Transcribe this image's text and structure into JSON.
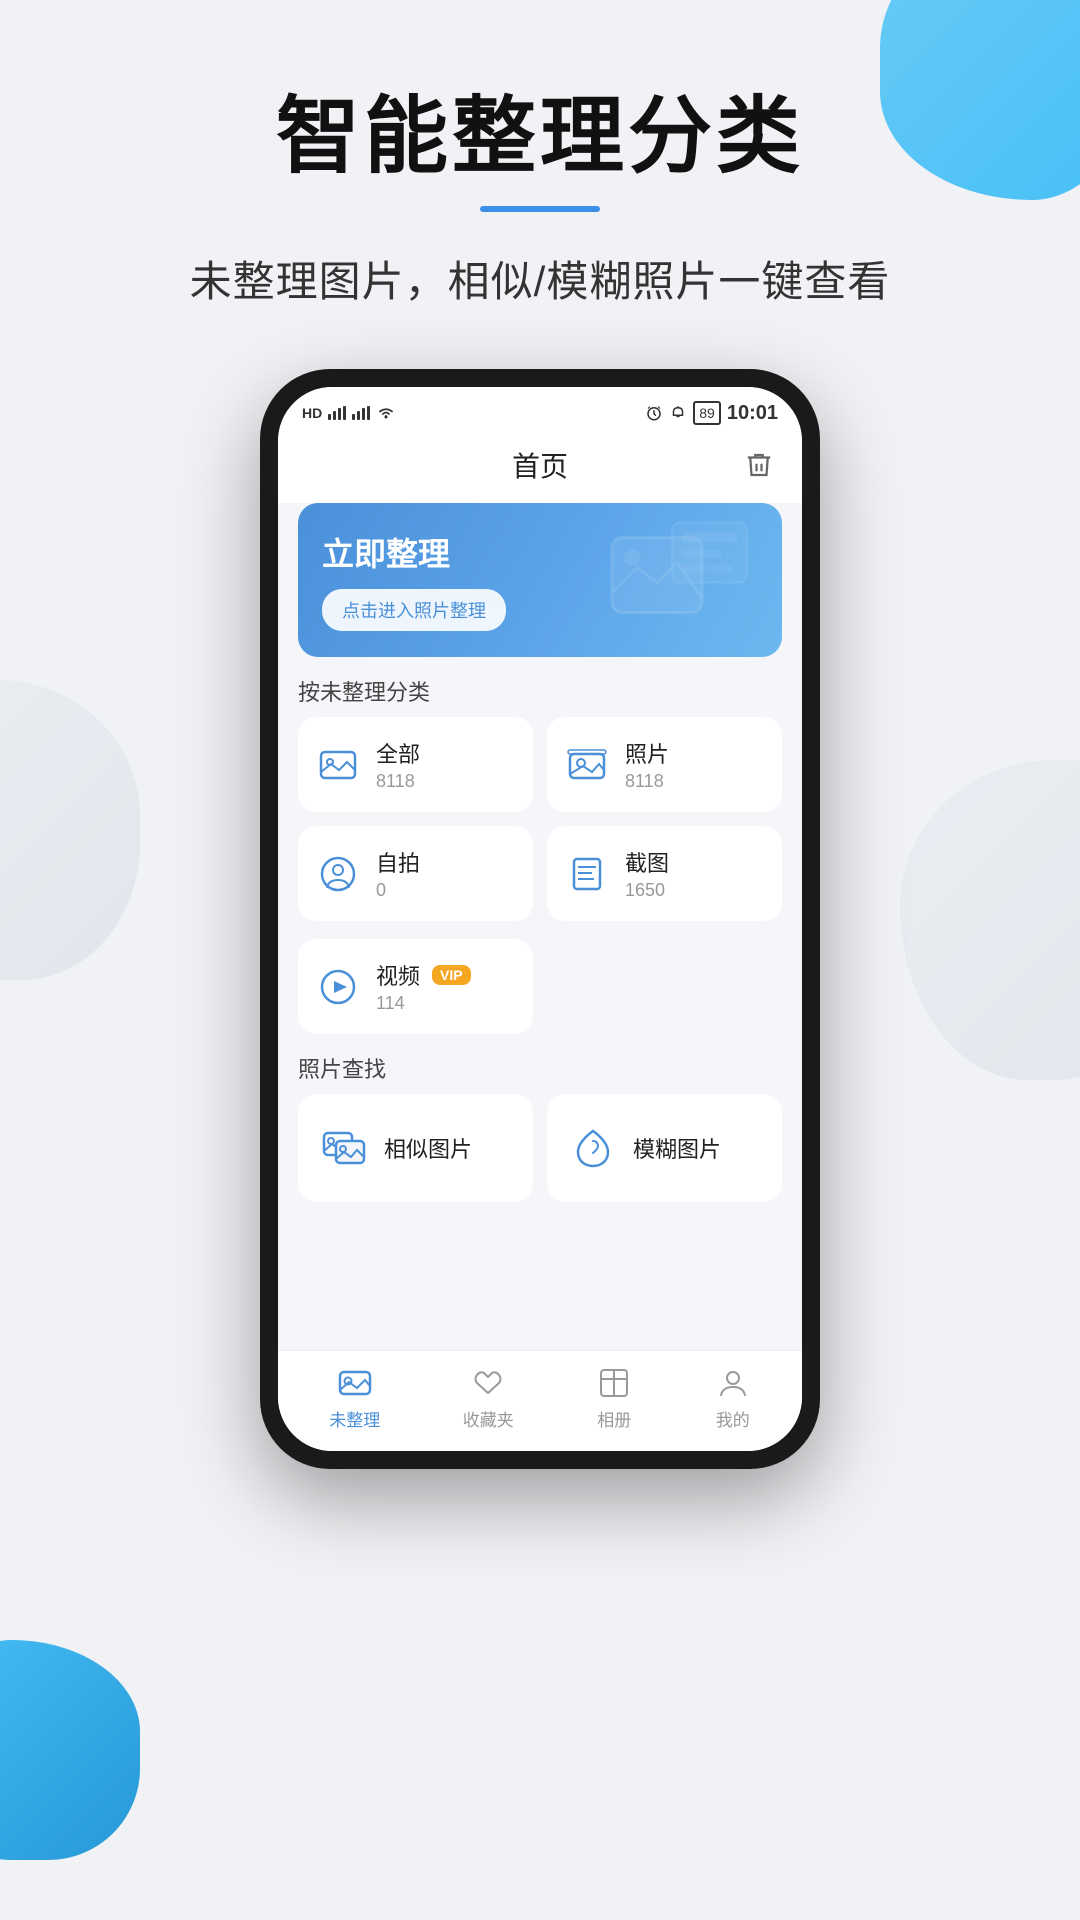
{
  "page": {
    "title": "智能整理分类",
    "subtitle": "未整理图片，相似/模糊照片一键查看",
    "accent_color": "#4a90d9",
    "background_color": "#f0f2f5"
  },
  "phone": {
    "status_bar": {
      "left": "HD  4G  4G  WiFi",
      "right": "10:01",
      "battery": "89"
    },
    "nav": {
      "title": "首页",
      "trash_label": "trash"
    },
    "banner": {
      "title": "立即整理",
      "button_label": "点击进入照片整理"
    },
    "categories_section_label": "按未整理分类",
    "categories": [
      {
        "name": "全部",
        "count": "8118",
        "icon": "all-photos"
      },
      {
        "name": "照片",
        "count": "8118",
        "icon": "photo"
      },
      {
        "name": "自拍",
        "count": "0",
        "icon": "selfie"
      },
      {
        "name": "截图",
        "count": "1650",
        "icon": "screenshot"
      },
      {
        "name": "视频",
        "count": "114",
        "icon": "video",
        "vip": "VIP"
      }
    ],
    "find_section_label": "照片查找",
    "find_items": [
      {
        "name": "相似图片",
        "icon": "similar-photos"
      },
      {
        "name": "模糊图片",
        "icon": "blurry-photos"
      }
    ],
    "bottom_nav": [
      {
        "label": "未整理",
        "icon": "unorganized",
        "active": true
      },
      {
        "label": "收藏夹",
        "icon": "favorites",
        "active": false
      },
      {
        "label": "相册",
        "icon": "album",
        "active": false
      },
      {
        "label": "我的",
        "icon": "profile",
        "active": false
      }
    ]
  }
}
